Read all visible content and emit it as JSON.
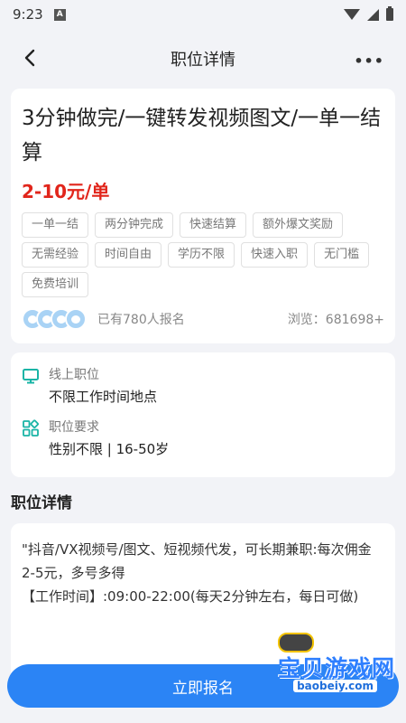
{
  "status_bar": {
    "time": "9:23",
    "notification_letter": "A"
  },
  "nav": {
    "title": "职位详情"
  },
  "job": {
    "title": "3分钟做完/一键转发视频图文/一单一结算",
    "salary": "2-10元/单",
    "tags": [
      "一单一结",
      "两分钟完成",
      "快速结算",
      "额外爆文奖励",
      "无需经验",
      "时间自由",
      "学历不限",
      "快速入职",
      "无门槛",
      "免费培训"
    ],
    "signup_text": "已有780人报名",
    "views_text": "浏览：681698+"
  },
  "info": {
    "type_label": "线上职位",
    "type_value": "不限工作时间地点",
    "req_label": "职位要求",
    "req_value": "性别不限 | 16-50岁"
  },
  "details": {
    "section_title": "职位详情",
    "text": "\"抖音/VX视频号/图文、短视频代发，可长期兼职:每次佣金2-5元，多号多得\n【工作时间】:09:00-22:00(每天2分钟左右，每日可做)"
  },
  "apply_button": {
    "label": "立即报名"
  },
  "watermark": {
    "brand": "宝贝游戏网",
    "url": "baobeiy.com"
  },
  "colors": {
    "accent": "#2b84f5",
    "salary": "#e1251b",
    "icon_teal": "#19b4a6"
  },
  "icons": {
    "back": "chevron-left-icon",
    "more": "more-dots-icon",
    "monitor": "monitor-icon",
    "grid": "grid-icon"
  }
}
